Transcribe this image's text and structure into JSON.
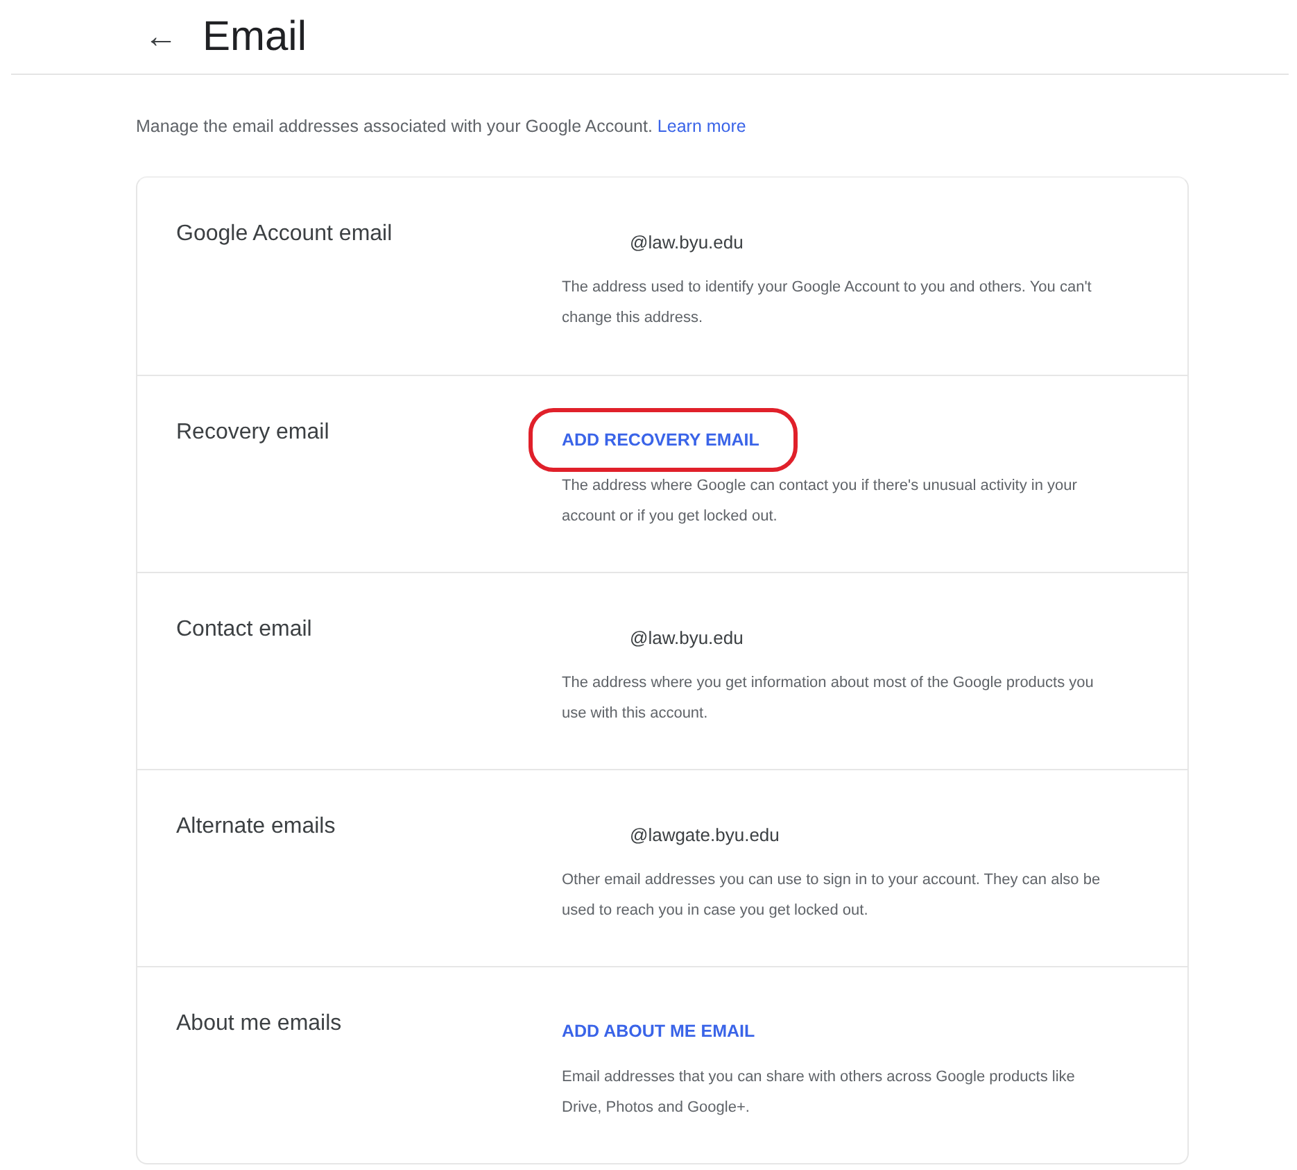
{
  "header": {
    "back_icon": "←",
    "title": "Email"
  },
  "intro": {
    "text": "Manage the email addresses associated with your Google Account.",
    "link": "Learn more"
  },
  "rows": [
    {
      "label": "Google Account email",
      "kind": "address",
      "value": "@law.byu.edu",
      "highlighted": false,
      "description": "The address used to identify your Google Account to you and others. You can't change this address."
    },
    {
      "label": "Recovery email",
      "kind": "action",
      "value": "ADD RECOVERY EMAIL",
      "highlighted": true,
      "description": "The address where Google can contact you if there's unusual activity in your account or if you get locked out."
    },
    {
      "label": "Contact email",
      "kind": "address",
      "value": "@law.byu.edu",
      "highlighted": false,
      "description": "The address where you get information about most of the Google products you use with this account."
    },
    {
      "label": "Alternate emails",
      "kind": "address",
      "value": "@lawgate.byu.edu",
      "highlighted": false,
      "description": "Other email addresses you can use to sign in to your account. They can also be used to reach you in case you get locked out."
    },
    {
      "label": "About me emails",
      "kind": "action",
      "value": "ADD ABOUT ME EMAIL",
      "highlighted": false,
      "description": "Email addresses that you can share with others across Google products like Drive, Photos and Google+."
    }
  ]
}
